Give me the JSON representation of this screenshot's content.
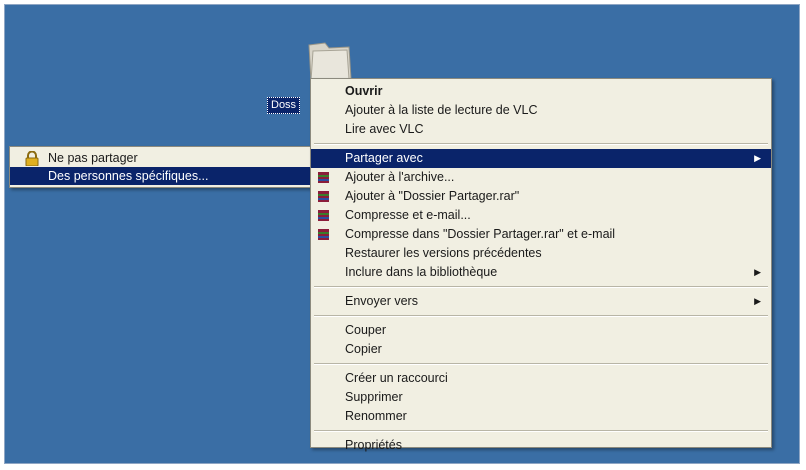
{
  "desktop": {
    "folder_label": "Doss"
  },
  "submenu": {
    "items": [
      {
        "label": "Ne pas partager",
        "icon": "lock-icon"
      },
      {
        "label": "Des personnes spécifiques...",
        "highlighted": true
      }
    ]
  },
  "menu": {
    "group1": [
      "Ouvrir",
      "Ajouter à la liste de lecture de VLC",
      "Lire avec VLC"
    ],
    "share_with": "Partager avec",
    "group2": [
      "Ajouter à l'archive...",
      "Ajouter à \"Dossier Partager.rar\"",
      "Compresse et e-mail...",
      "Compresse dans \"Dossier Partager.rar\" et e-mail",
      "Restaurer les versions précédentes",
      "Inclure dans la bibliothèque"
    ],
    "send_to": "Envoyer vers",
    "group3": [
      "Couper",
      "Copier"
    ],
    "group4": [
      "Créer un raccourci",
      "Supprimer",
      "Renommer"
    ],
    "properties": "Propriétés"
  },
  "colors": {
    "desktop": "#3a6ea5",
    "menu_bg": "#f1efe2",
    "highlight": "#0a246a"
  }
}
